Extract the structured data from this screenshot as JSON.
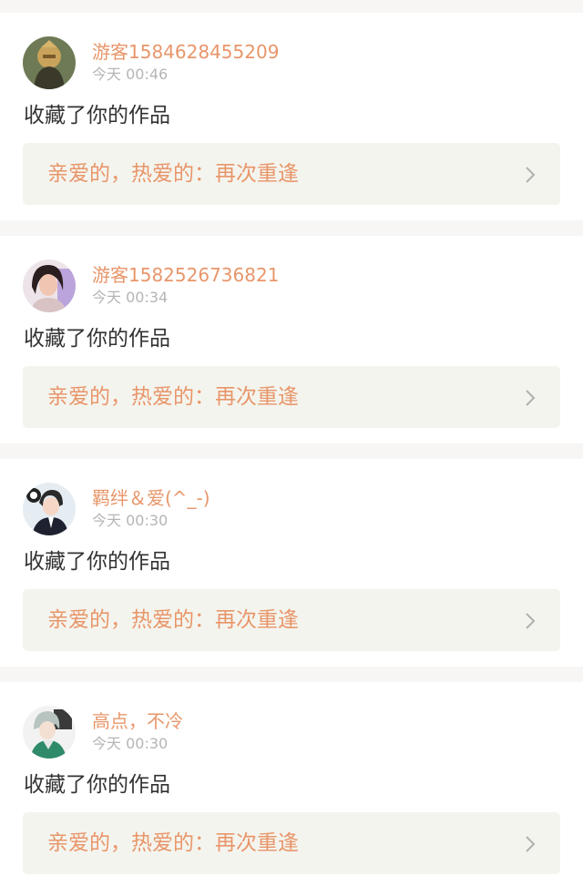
{
  "notifications": [
    {
      "username": "游客1584628455209",
      "time": "今天 00:46",
      "action": "收藏了你的作品",
      "work_title": "亲爱的，热爱的：再次重逢",
      "avatar_icon": "avatar-icon"
    },
    {
      "username": "游客1582526736821",
      "time": "今天 00:34",
      "action": "收藏了你的作品",
      "work_title": "亲爱的，热爱的：再次重逢",
      "avatar_icon": "avatar-icon"
    },
    {
      "username": "羁绊＆爱(^_-)",
      "time": "今天 00:30",
      "action": "收藏了你的作品",
      "work_title": "亲爱的，热爱的：再次重逢",
      "avatar_icon": "avatar-icon"
    },
    {
      "username": "高点，不冷",
      "time": "今天 00:30",
      "action": "收藏了你的作品",
      "work_title": "亲爱的，热爱的：再次重逢",
      "avatar_icon": "avatar-icon"
    }
  ],
  "colors": {
    "accent": "#e8966a",
    "time_text": "#b5b5b5",
    "body_text": "#333333",
    "link_bg": "#f4f4ee",
    "page_bg": "#f7f6f5"
  }
}
